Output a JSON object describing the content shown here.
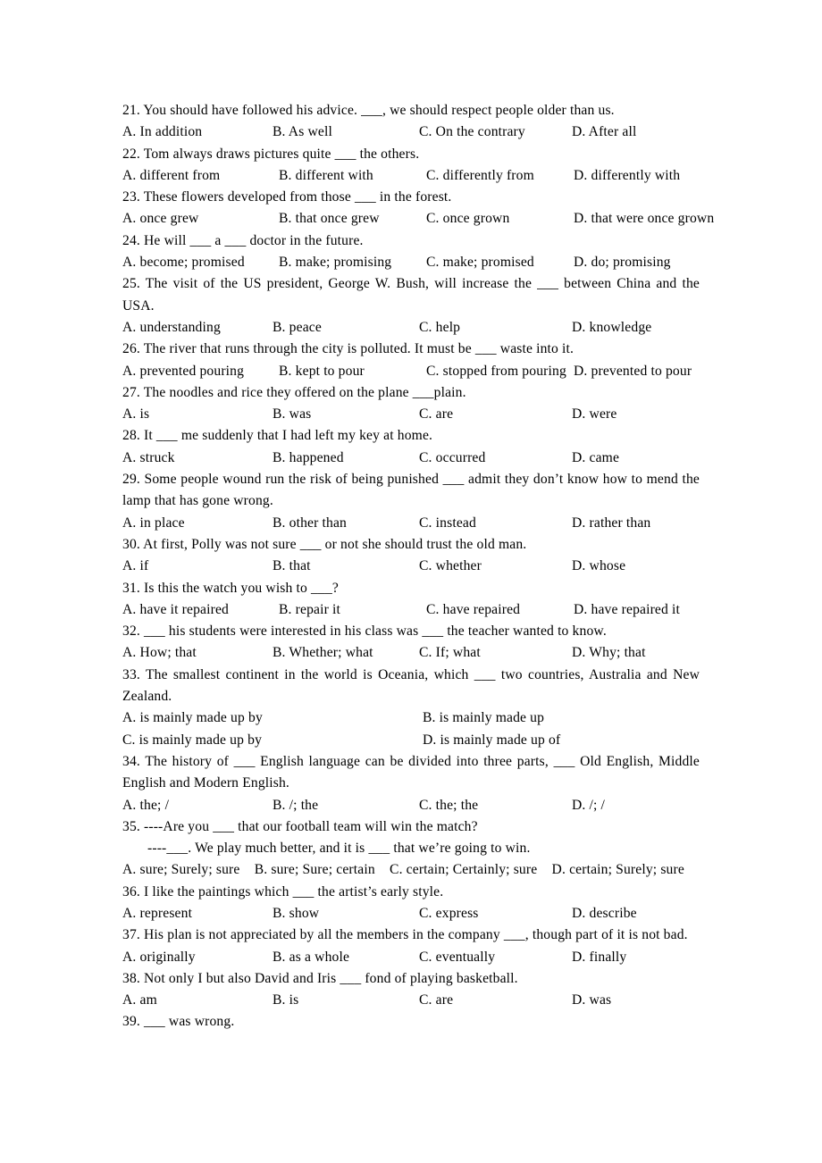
{
  "document": {
    "page_background": "#ffffff",
    "text_color": "#000000",
    "questions": [
      {
        "number": "21.",
        "stem": "21. You should have followed his advice. ___, we should respect people older than us.",
        "layout": "tabbed",
        "options": [
          "A. In addition",
          "B. As well",
          "C. On the contrary",
          "D. After all"
        ]
      },
      {
        "number": "22.",
        "stem": "22. Tom always draws pictures quite ___ the others.",
        "layout": "wide",
        "options": [
          "A. different from",
          "B. different with",
          "C. differently from",
          "D. differently with"
        ]
      },
      {
        "number": "23.",
        "stem": "23. These flowers developed from those ___ in the forest.",
        "layout": "wide",
        "options": [
          "A. once grew",
          "B. that once grew",
          "C. once grown",
          "D. that were once grown"
        ]
      },
      {
        "number": "24.",
        "stem": "24. He will ___ a ___ doctor in the future.",
        "layout": "wide",
        "options": [
          "A. become; promised",
          "B. make; promising",
          "C. make; promised",
          "D. do; promising"
        ]
      },
      {
        "number": "25.",
        "stem": "25. The visit of the US president, George W. Bush, will increase the ___ between China and the USA.",
        "layout": "tabbed",
        "options": [
          "A. understanding",
          "B. peace",
          "C. help",
          "D. knowledge"
        ]
      },
      {
        "number": "26.",
        "stem": "26. The river that runs through the city is polluted. It must be ___ waste into it.",
        "layout": "wide",
        "options": [
          "A. prevented pouring",
          "B. kept to pour",
          "C. stopped from pouring",
          "D. prevented to pour"
        ]
      },
      {
        "number": "27.",
        "stem": "27. The noodles and rice they offered on the plane ___plain.",
        "layout": "tabbed",
        "options": [
          "A. is",
          "B. was",
          "C. are",
          "D. were"
        ]
      },
      {
        "number": "28.",
        "stem": "28. It ___ me suddenly that I had left my key at home.",
        "layout": "tabbed",
        "options": [
          "A. struck",
          "B. happened",
          "C. occurred",
          "D. came"
        ]
      },
      {
        "number": "29.",
        "stem": "29. Some people wound run the risk of being punished ___ admit they don’t know how to mend the lamp that has gone wrong.",
        "layout": "tabbed",
        "options": [
          "A. in place",
          "B. other than",
          "C. instead",
          "D. rather than"
        ]
      },
      {
        "number": "30.",
        "stem": "30. At first, Polly was not sure ___ or not she should trust the old man.",
        "layout": "tabbed",
        "options": [
          "A. if",
          "B. that",
          "C. whether",
          "D. whose"
        ]
      },
      {
        "number": "31.",
        "stem": "31. Is this the watch you wish to ___?",
        "layout": "wide",
        "options": [
          "A. have it repaired",
          "B. repair it",
          "C. have repaired",
          "D. have repaired it"
        ]
      },
      {
        "number": "32.",
        "stem": "32. ___ his students were interested in his class was ___ the teacher wanted to know.",
        "layout": "tabbed",
        "options": [
          "A. How; that",
          "B. Whether; what",
          "C. If; what",
          "D. Why; that"
        ]
      },
      {
        "number": "33.",
        "stem": "33. The smallest continent in the world is Oceania, which ___ two countries, Australia and New Zealand.",
        "layout": "two-col",
        "options": [
          "A. is mainly made up by",
          "B. is mainly made up",
          "C. is mainly made up by",
          "D. is mainly made up of"
        ]
      },
      {
        "number": "34.",
        "stem": "34. The history of ___ English language can be divided into three parts, ___ Old English, Middle English and Modern English.",
        "layout": "tabbed",
        "options": [
          "A. the; /",
          "B. /; the",
          "C. the; the",
          "D. /; /"
        ]
      },
      {
        "number": "35.",
        "stem": "35. ----Are you ___ that our football team will win the match?",
        "stem_line2": "----___. We play much better, and it is ___ that we’re going to win.",
        "layout": "tight",
        "options": [
          "A. sure; Surely; sure",
          "B. sure; Sure; certain",
          "C. certain; Certainly; sure",
          "D. certain; Surely; sure"
        ]
      },
      {
        "number": "36.",
        "stem": "36. I like the paintings which ___ the artist’s early style.",
        "layout": "tabbed",
        "options": [
          "A. represent",
          "B. show",
          "C. express",
          "D. describe"
        ]
      },
      {
        "number": "37.",
        "stem": "37. His plan is not appreciated by all the members in the company ___, though part of it is not bad.",
        "layout": "tabbed",
        "options": [
          "A. originally",
          "B. as a whole",
          "C. eventually",
          "D. finally"
        ]
      },
      {
        "number": "38.",
        "stem": "38. Not only I but also David and Iris ___ fond of playing basketball.",
        "layout": "tabbed",
        "options": [
          "A. am",
          "B. is",
          "C. are",
          "D. was"
        ]
      },
      {
        "number": "39.",
        "stem": "39. ___ was wrong.",
        "layout": "none",
        "options": []
      }
    ]
  }
}
